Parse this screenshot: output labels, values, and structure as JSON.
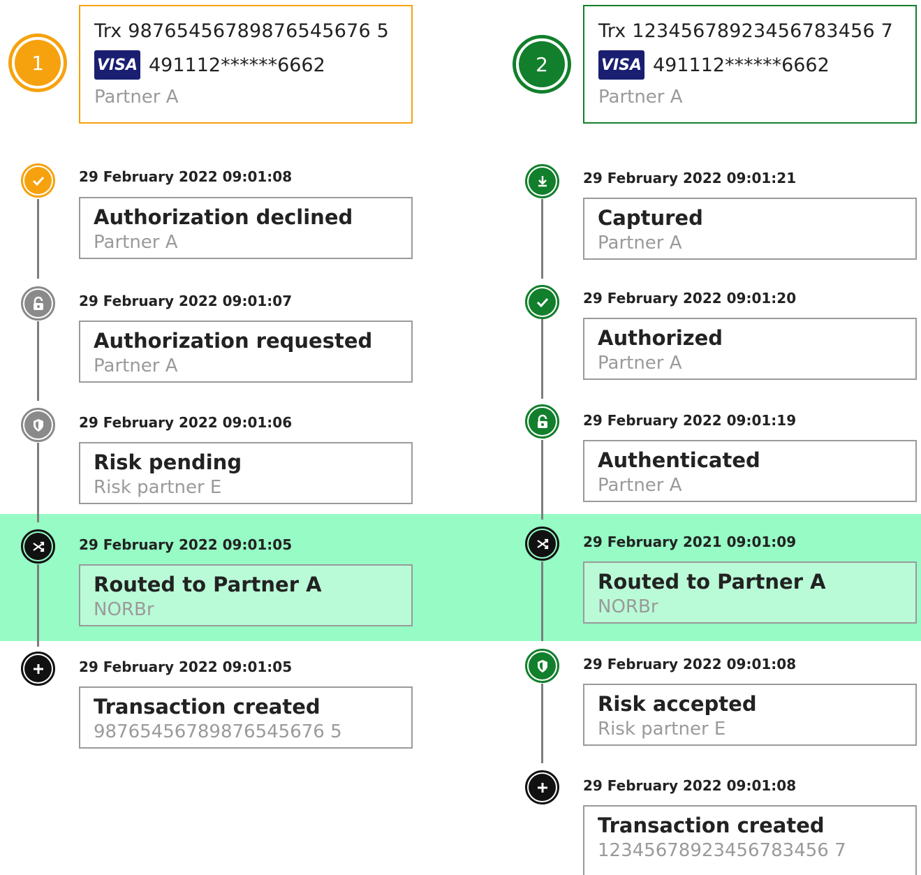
{
  "transactions": [
    {
      "step_number": "1",
      "trx_label": "Trx 98765456789876545676 5",
      "card_brand": "VISA",
      "card_pan": "491112******6662",
      "partner": "Partner A",
      "accent_color": "#f6a20f",
      "events": [
        {
          "date": "29 February 2022 09:01:08",
          "title": "Authorization declined",
          "subtitle": "Partner A",
          "icon": "check-icon",
          "icon_color": "orange"
        },
        {
          "date": "29 February 2022 09:01:07",
          "title": "Authorization requested",
          "subtitle": "Partner A",
          "icon": "lock-icon",
          "icon_color": "grey"
        },
        {
          "date": "29 February 2022 09:01:06",
          "title": "Risk pending",
          "subtitle": "Risk partner E",
          "icon": "shield-icon",
          "icon_color": "grey"
        },
        {
          "date": "29 February 2022 09:01:05",
          "title": "Routed to Partner A",
          "subtitle": "NORBr",
          "icon": "shuffle-icon",
          "icon_color": "black",
          "highlighted": true
        },
        {
          "date": "29 February 2022 09:01:05",
          "title": "Transaction created",
          "subtitle": "98765456789876545676 5",
          "icon": "plus-icon",
          "icon_color": "black"
        }
      ]
    },
    {
      "step_number": "2",
      "trx_label": "Trx 12345678923456783456 7",
      "card_brand": "VISA",
      "card_pan": "491112******6662",
      "partner": "Partner A",
      "accent_color": "#127f2c",
      "events": [
        {
          "date": "29 February 2022 09:01:21",
          "title": "Captured",
          "subtitle": "Partner A",
          "icon": "download-icon",
          "icon_color": "green"
        },
        {
          "date": "29 February 2022 09:01:20",
          "title": "Authorized",
          "subtitle": "Partner A",
          "icon": "check-icon",
          "icon_color": "green"
        },
        {
          "date": "29 February 2022 09:01:19",
          "title": "Authenticated",
          "subtitle": "Partner A",
          "icon": "lock-icon",
          "icon_color": "green"
        },
        {
          "date": "29 February 2021 09:01:09",
          "title": "Routed to Partner A",
          "subtitle": "NORBr",
          "icon": "shuffle-icon",
          "icon_color": "black",
          "highlighted": true
        },
        {
          "date": "29 February 2022 09:01:08",
          "title": "Risk accepted",
          "subtitle": "Risk partner E",
          "icon": "shield-icon",
          "icon_color": "green"
        },
        {
          "date": "29 February 2022 09:01:08",
          "title": "Transaction created",
          "subtitle": "12345678923456783456 7",
          "icon": "plus-icon",
          "icon_color": "black"
        }
      ]
    }
  ],
  "highlight_color": "#96fbc5"
}
